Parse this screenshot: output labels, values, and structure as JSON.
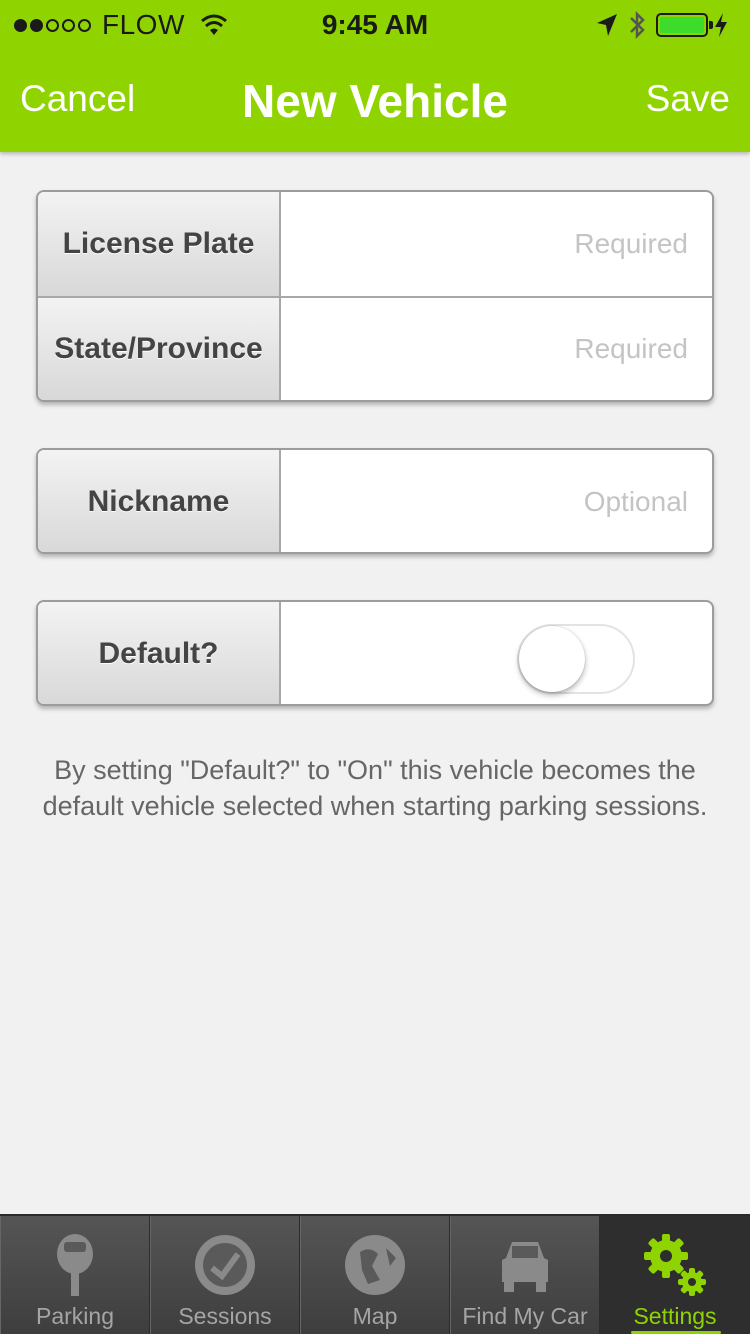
{
  "status_bar": {
    "carrier": "FLOW",
    "time": "9:45 AM",
    "signal_dots_filled": 2,
    "signal_dots_total": 5,
    "battery_color": "#3ddc2a"
  },
  "nav": {
    "cancel_label": "Cancel",
    "title": "New Vehicle",
    "save_label": "Save",
    "bar_color": "#8fd400"
  },
  "form": {
    "license_plate": {
      "label": "License Plate",
      "value": "",
      "placeholder": "Required"
    },
    "state_province": {
      "label": "State/Province",
      "value": "",
      "placeholder": "Required"
    },
    "nickname": {
      "label": "Nickname",
      "value": "",
      "placeholder": "Optional"
    },
    "default": {
      "label": "Default?",
      "on": false
    }
  },
  "help_text": "By setting \"Default?\" to \"On\" this vehicle becomes the default vehicle selected when starting parking sessions.",
  "tabs": [
    {
      "label": "Parking",
      "icon": "parking-meter-icon",
      "active": false
    },
    {
      "label": "Sessions",
      "icon": "clock-icon",
      "active": false
    },
    {
      "label": "Map",
      "icon": "globe-icon",
      "active": false
    },
    {
      "label": "Find My Car",
      "icon": "car-icon",
      "active": false
    },
    {
      "label": "Settings",
      "icon": "gears-icon",
      "active": true
    }
  ],
  "accent_color": "#8fd400"
}
